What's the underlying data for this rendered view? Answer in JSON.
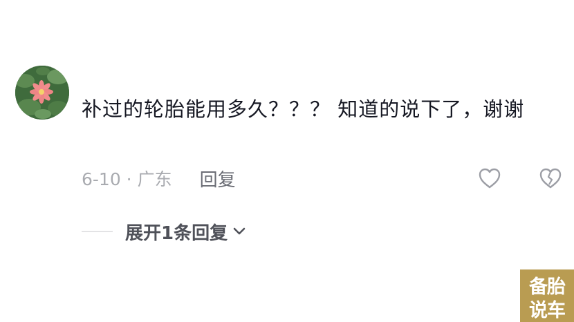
{
  "comment": {
    "text": "补过的轮胎能用多久？？？ 知道的说下了，谢谢",
    "date_location": "6-10 · 广东",
    "reply_label": "回复"
  },
  "replies": {
    "expand_label": "展开1条回复"
  },
  "icons": {
    "like": "heart-outline-icon",
    "dislike": "broken-heart-icon",
    "expand": "chevron-down-icon"
  },
  "watermark": {
    "text": "备胎说车"
  },
  "colors": {
    "text_primary": "#161823",
    "text_secondary": "#a9abb0",
    "reply": "#6b6d75",
    "watermark_bg": "#b99c52"
  }
}
